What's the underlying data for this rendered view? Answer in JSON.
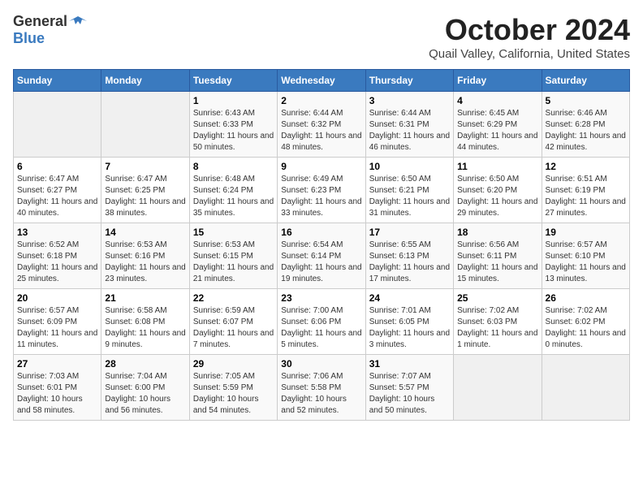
{
  "header": {
    "logo_general": "General",
    "logo_blue": "Blue",
    "title": "October 2024",
    "subtitle": "Quail Valley, California, United States"
  },
  "weekdays": [
    "Sunday",
    "Monday",
    "Tuesday",
    "Wednesday",
    "Thursday",
    "Friday",
    "Saturday"
  ],
  "weeks": [
    [
      {
        "day": "",
        "empty": true
      },
      {
        "day": "",
        "empty": true
      },
      {
        "day": "1",
        "sunrise": "6:43 AM",
        "sunset": "6:33 PM",
        "daylight": "11 hours and 50 minutes."
      },
      {
        "day": "2",
        "sunrise": "6:44 AM",
        "sunset": "6:32 PM",
        "daylight": "11 hours and 48 minutes."
      },
      {
        "day": "3",
        "sunrise": "6:44 AM",
        "sunset": "6:31 PM",
        "daylight": "11 hours and 46 minutes."
      },
      {
        "day": "4",
        "sunrise": "6:45 AM",
        "sunset": "6:29 PM",
        "daylight": "11 hours and 44 minutes."
      },
      {
        "day": "5",
        "sunrise": "6:46 AM",
        "sunset": "6:28 PM",
        "daylight": "11 hours and 42 minutes."
      }
    ],
    [
      {
        "day": "6",
        "sunrise": "6:47 AM",
        "sunset": "6:27 PM",
        "daylight": "11 hours and 40 minutes."
      },
      {
        "day": "7",
        "sunrise": "6:47 AM",
        "sunset": "6:25 PM",
        "daylight": "11 hours and 38 minutes."
      },
      {
        "day": "8",
        "sunrise": "6:48 AM",
        "sunset": "6:24 PM",
        "daylight": "11 hours and 35 minutes."
      },
      {
        "day": "9",
        "sunrise": "6:49 AM",
        "sunset": "6:23 PM",
        "daylight": "11 hours and 33 minutes."
      },
      {
        "day": "10",
        "sunrise": "6:50 AM",
        "sunset": "6:21 PM",
        "daylight": "11 hours and 31 minutes."
      },
      {
        "day": "11",
        "sunrise": "6:50 AM",
        "sunset": "6:20 PM",
        "daylight": "11 hours and 29 minutes."
      },
      {
        "day": "12",
        "sunrise": "6:51 AM",
        "sunset": "6:19 PM",
        "daylight": "11 hours and 27 minutes."
      }
    ],
    [
      {
        "day": "13",
        "sunrise": "6:52 AM",
        "sunset": "6:18 PM",
        "daylight": "11 hours and 25 minutes."
      },
      {
        "day": "14",
        "sunrise": "6:53 AM",
        "sunset": "6:16 PM",
        "daylight": "11 hours and 23 minutes."
      },
      {
        "day": "15",
        "sunrise": "6:53 AM",
        "sunset": "6:15 PM",
        "daylight": "11 hours and 21 minutes."
      },
      {
        "day": "16",
        "sunrise": "6:54 AM",
        "sunset": "6:14 PM",
        "daylight": "11 hours and 19 minutes."
      },
      {
        "day": "17",
        "sunrise": "6:55 AM",
        "sunset": "6:13 PM",
        "daylight": "11 hours and 17 minutes."
      },
      {
        "day": "18",
        "sunrise": "6:56 AM",
        "sunset": "6:11 PM",
        "daylight": "11 hours and 15 minutes."
      },
      {
        "day": "19",
        "sunrise": "6:57 AM",
        "sunset": "6:10 PM",
        "daylight": "11 hours and 13 minutes."
      }
    ],
    [
      {
        "day": "20",
        "sunrise": "6:57 AM",
        "sunset": "6:09 PM",
        "daylight": "11 hours and 11 minutes."
      },
      {
        "day": "21",
        "sunrise": "6:58 AM",
        "sunset": "6:08 PM",
        "daylight": "11 hours and 9 minutes."
      },
      {
        "day": "22",
        "sunrise": "6:59 AM",
        "sunset": "6:07 PM",
        "daylight": "11 hours and 7 minutes."
      },
      {
        "day": "23",
        "sunrise": "7:00 AM",
        "sunset": "6:06 PM",
        "daylight": "11 hours and 5 minutes."
      },
      {
        "day": "24",
        "sunrise": "7:01 AM",
        "sunset": "6:05 PM",
        "daylight": "11 hours and 3 minutes."
      },
      {
        "day": "25",
        "sunrise": "7:02 AM",
        "sunset": "6:03 PM",
        "daylight": "11 hours and 1 minute."
      },
      {
        "day": "26",
        "sunrise": "7:02 AM",
        "sunset": "6:02 PM",
        "daylight": "11 hours and 0 minutes."
      }
    ],
    [
      {
        "day": "27",
        "sunrise": "7:03 AM",
        "sunset": "6:01 PM",
        "daylight": "10 hours and 58 minutes."
      },
      {
        "day": "28",
        "sunrise": "7:04 AM",
        "sunset": "6:00 PM",
        "daylight": "10 hours and 56 minutes."
      },
      {
        "day": "29",
        "sunrise": "7:05 AM",
        "sunset": "5:59 PM",
        "daylight": "10 hours and 54 minutes."
      },
      {
        "day": "30",
        "sunrise": "7:06 AM",
        "sunset": "5:58 PM",
        "daylight": "10 hours and 52 minutes."
      },
      {
        "day": "31",
        "sunrise": "7:07 AM",
        "sunset": "5:57 PM",
        "daylight": "10 hours and 50 minutes."
      },
      {
        "day": "",
        "empty": true
      },
      {
        "day": "",
        "empty": true
      }
    ]
  ],
  "labels": {
    "sunrise": "Sunrise:",
    "sunset": "Sunset:",
    "daylight": "Daylight:"
  }
}
